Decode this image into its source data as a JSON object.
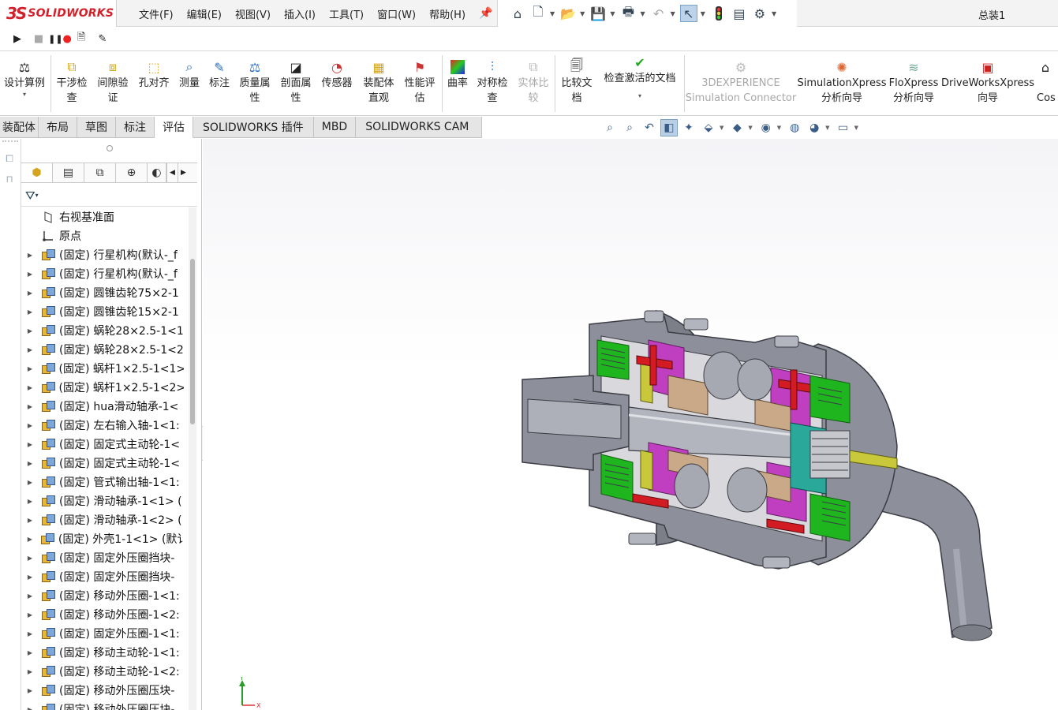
{
  "app": {
    "logo_ds": "3S",
    "logo_text": "SOLIDWORKS",
    "document_title": "总装1"
  },
  "menu": [
    "文件(F)",
    "编辑(E)",
    "视图(V)",
    "插入(I)",
    "工具(T)",
    "窗口(W)",
    "帮助(H)"
  ],
  "quick_access": [
    "home-icon",
    "new-document-icon",
    "open-icon",
    "save-icon",
    "print-icon",
    "undo-icon",
    "select-icon",
    "rebuild-icon",
    "file-properties-icon",
    "options-icon"
  ],
  "macro_toolbar": [
    "play-macro-icon",
    "stop-macro-icon",
    "record-pause-macro-icon",
    "new-macro-icon",
    "edit-macro-icon"
  ],
  "command_manager": {
    "design_study": "设计算例",
    "interference_1": "干涉检",
    "interference_2": "查",
    "clearance_1": "间隙验",
    "clearance_2": "证",
    "hole_align": "孔对齐",
    "measure": "测量",
    "markup": "标注",
    "mass_props_1": "质量属",
    "mass_props_2": "性",
    "section_props_1": "剖面属",
    "section_props_2": "性",
    "sensor": "传感器",
    "asm_viz_1": "装配体",
    "asm_viz_2": "直观",
    "perf_1": "性能评",
    "perf_2": "估",
    "curvature": "曲率",
    "symmetry_1": "对称检",
    "symmetry_2": "查",
    "compare_body_1": "实体比",
    "compare_body_2": "较",
    "compare_doc_1": "比较文",
    "compare_doc_2": "档",
    "check_active": "检查激活的文档",
    "exp_1": "3DEXPERIENCE",
    "exp_2": "Simulation Connector",
    "simx_1": "SimulationXpress",
    "simx_2": "分析向导",
    "flox_1": "FloXpress",
    "flox_2": "分析向导",
    "dwx_1": "DriveWorksXpress",
    "dwx_2": "向导",
    "cost": "Cos"
  },
  "tabs": [
    {
      "label": "装配体",
      "active": false
    },
    {
      "label": "布局",
      "active": false
    },
    {
      "label": "草图",
      "active": false
    },
    {
      "label": "标注",
      "active": false
    },
    {
      "label": "评估",
      "active": true
    },
    {
      "label": "SOLIDWORKS 插件",
      "active": false
    },
    {
      "label": "MBD",
      "active": false
    },
    {
      "label": "SOLIDWORKS CAM",
      "active": false
    }
  ],
  "feature_tree": {
    "items": [
      {
        "label": "右视基准面",
        "type": "plane",
        "expandable": false
      },
      {
        "label": "原点",
        "type": "origin",
        "expandable": false
      },
      {
        "label": "(固定) 行星机构(默认-_f",
        "type": "subassembly",
        "expandable": true
      },
      {
        "label": "(固定) 行星机构(默认-_f",
        "type": "subassembly",
        "expandable": true
      },
      {
        "label": "(固定) 圆锥齿轮75×2-1",
        "type": "subassembly",
        "expandable": true
      },
      {
        "label": "(固定) 圆锥齿轮15×2-1",
        "type": "subassembly",
        "expandable": true
      },
      {
        "label": "(固定) 蜗轮28×2.5-1<1",
        "type": "subassembly",
        "expandable": true
      },
      {
        "label": "(固定) 蜗轮28×2.5-1<2",
        "type": "subassembly",
        "expandable": true
      },
      {
        "label": "(固定) 蜗杆1×2.5-1<1>",
        "type": "subassembly",
        "expandable": true
      },
      {
        "label": "(固定) 蜗杆1×2.5-1<2>",
        "type": "subassembly",
        "expandable": true
      },
      {
        "label": "(固定) hua滑动轴承-1<",
        "type": "subassembly",
        "expandable": true
      },
      {
        "label": "(固定) 左右输入轴-1<1:",
        "type": "subassembly",
        "expandable": true
      },
      {
        "label": "(固定) 固定式主动轮-1<",
        "type": "subassembly",
        "expandable": true
      },
      {
        "label": "(固定) 固定式主动轮-1<",
        "type": "subassembly",
        "expandable": true
      },
      {
        "label": "(固定) 管式输出轴-1<1:",
        "type": "subassembly",
        "expandable": true
      },
      {
        "label": "(固定) 滑动轴承-1<1> (",
        "type": "subassembly",
        "expandable": true
      },
      {
        "label": "(固定) 滑动轴承-1<2> (",
        "type": "subassembly",
        "expandable": true
      },
      {
        "label": "(固定) 外壳1-1<1> (默讠",
        "type": "subassembly",
        "expandable": true
      },
      {
        "label": "(固定) 固定外压圈挡块-",
        "type": "subassembly",
        "expandable": true
      },
      {
        "label": "(固定) 固定外压圈挡块-",
        "type": "subassembly",
        "expandable": true
      },
      {
        "label": "(固定) 移动外压圈-1<1:",
        "type": "subassembly",
        "expandable": true
      },
      {
        "label": "(固定) 移动外压圈-1<2:",
        "type": "subassembly",
        "expandable": true
      },
      {
        "label": "(固定) 固定外压圈-1<1:",
        "type": "subassembly",
        "expandable": true
      },
      {
        "label": "(固定) 移动主动轮-1<1:",
        "type": "subassembly",
        "expandable": true
      },
      {
        "label": "(固定) 移动主动轮-1<2:",
        "type": "subassembly",
        "expandable": true
      },
      {
        "label": "(固定) 移动外压圈压块-",
        "type": "subassembly",
        "expandable": true
      },
      {
        "label": "(固定) 移动外压圈压块-",
        "type": "subassembly",
        "expandable": true
      }
    ]
  },
  "triad": {
    "y_label": "Y",
    "x_label": "X"
  },
  "colors": {
    "housing": "#8d8f9a",
    "housing_dark": "#5c5e68",
    "green_part": "#1fb51f",
    "red_part": "#d21b22",
    "magenta_part": "#c03fc0",
    "yellow_part": "#c8c83a",
    "tan_part": "#c9a988",
    "teal_part": "#2aa89a"
  }
}
